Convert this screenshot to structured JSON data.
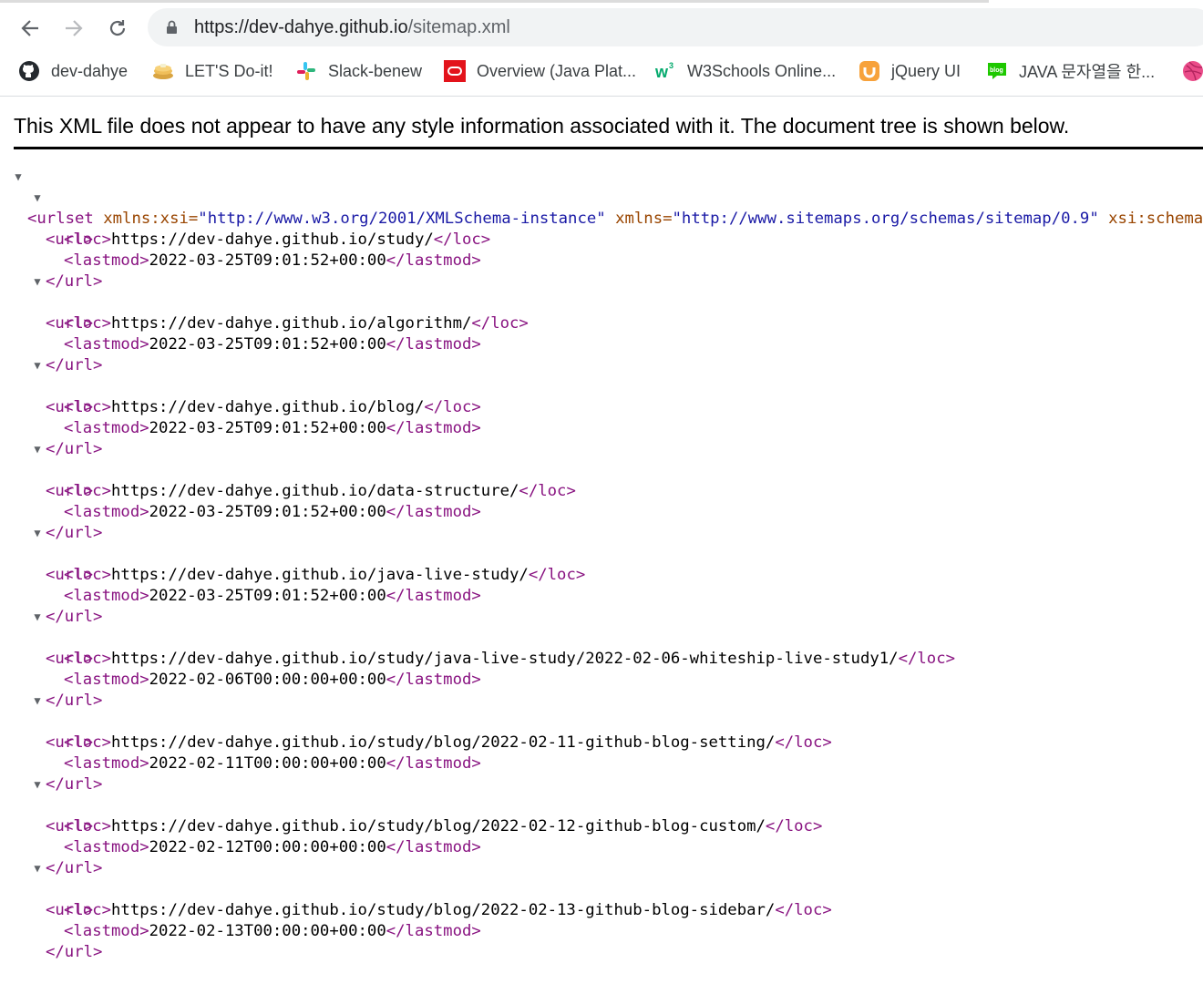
{
  "browser": {
    "url_host": "https://dev-dahye.github.io",
    "url_path": "/sitemap.xml"
  },
  "bookmarks": [
    {
      "label": "dev-dahye",
      "icon": "github-icon"
    },
    {
      "label": "LET'S Do-it!",
      "icon": "pancake-icon"
    },
    {
      "label": "Slack-benew",
      "icon": "slack-icon"
    },
    {
      "label": "Overview (Java Plat...",
      "icon": "oracle-icon"
    },
    {
      "label": "W3Schools Online...",
      "icon": "w3schools-icon"
    },
    {
      "label": "jQuery UI",
      "icon": "jquery-ui-icon"
    },
    {
      "label": "JAVA 문자열을 한...",
      "icon": "blog-icon"
    }
  ],
  "notice": "This XML file does not appear to have any style information associated with it. The document tree is shown below.",
  "xml": {
    "urlset_open": "<urlset",
    "attrs": [
      {
        "name": "xmlns:xsi",
        "value": "\"http://www.w3.org/2001/XMLSchema-instance\""
      },
      {
        "name": "xmlns",
        "value": "\"http://www.sitemaps.org/schemas/sitemap/0.9\""
      },
      {
        "name": "xsi:schemaLocat",
        "value": ""
      }
    ],
    "urls": [
      {
        "loc": "https://dev-dahye.github.io/study/",
        "lastmod": "2022-03-25T09:01:52+00:00"
      },
      {
        "loc": "https://dev-dahye.github.io/algorithm/",
        "lastmod": "2022-03-25T09:01:52+00:00"
      },
      {
        "loc": "https://dev-dahye.github.io/blog/",
        "lastmod": "2022-03-25T09:01:52+00:00"
      },
      {
        "loc": "https://dev-dahye.github.io/data-structure/",
        "lastmod": "2022-03-25T09:01:52+00:00"
      },
      {
        "loc": "https://dev-dahye.github.io/java-live-study/",
        "lastmod": "2022-03-25T09:01:52+00:00"
      },
      {
        "loc": "https://dev-dahye.github.io/study/java-live-study/2022-02-06-whiteship-live-study1/",
        "lastmod": "2022-02-06T00:00:00+00:00"
      },
      {
        "loc": "https://dev-dahye.github.io/study/blog/2022-02-11-github-blog-setting/",
        "lastmod": "2022-02-11T00:00:00+00:00"
      },
      {
        "loc": "https://dev-dahye.github.io/study/blog/2022-02-12-github-blog-custom/",
        "lastmod": "2022-02-12T00:00:00+00:00"
      },
      {
        "loc": "https://dev-dahye.github.io/study/blog/2022-02-13-github-blog-sidebar/",
        "lastmod": "2022-02-13T00:00:00+00:00"
      }
    ],
    "tags": {
      "url_open": "<url>",
      "url_close": "</url>",
      "loc_open": "<loc>",
      "loc_close": "</loc>",
      "lastmod_open": "<lastmod>",
      "lastmod_close": "</lastmod>"
    }
  }
}
